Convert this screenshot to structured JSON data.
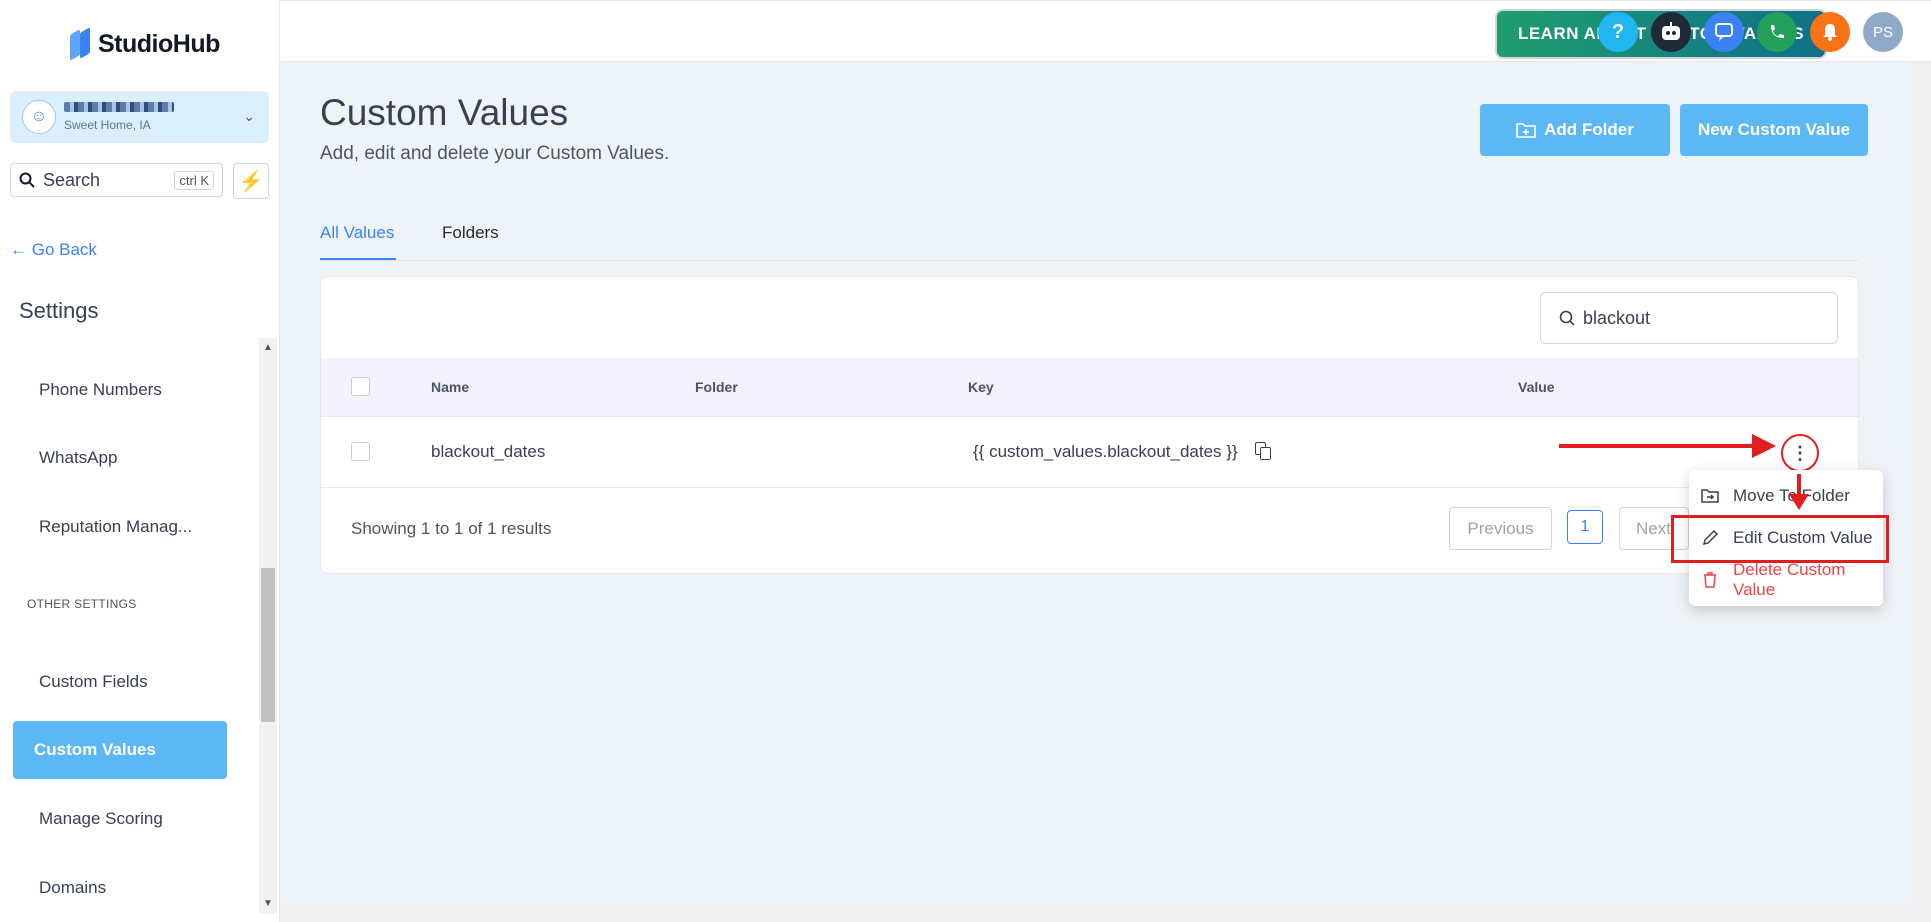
{
  "app": {
    "brand": "StudioHub"
  },
  "account": {
    "location": "Sweet Home, IA"
  },
  "sidebar": {
    "search_label": "Search",
    "search_shortcut": "ctrl K",
    "go_back": "Go Back",
    "section_title": "Settings",
    "items": [
      {
        "label": "Phone Numbers"
      },
      {
        "label": "WhatsApp"
      },
      {
        "label": "Reputation Manag..."
      }
    ],
    "other_settings_header": "OTHER SETTINGS",
    "other_items": [
      {
        "label": "Custom Fields"
      },
      {
        "label": "Custom Values",
        "active": true
      },
      {
        "label": "Manage Scoring"
      },
      {
        "label": "Domains"
      }
    ]
  },
  "topbar": {
    "learn_button": "LEARN ABOUT CUSTOM VALUES",
    "help_glyph": "?",
    "user_initials": "PS",
    "icons": [
      "help-icon",
      "robot-icon",
      "chat-icon",
      "phone-icon",
      "bell-icon",
      "avatar"
    ],
    "colors": {
      "help": "#1fb6f2",
      "robot": "#1f2937",
      "chat": "#3b82f6",
      "phone": "#22a05a",
      "bell": "#f97316",
      "avatar": "#8fa9c8"
    }
  },
  "page": {
    "title": "Custom Values",
    "subtitle": "Add, edit and delete your Custom Values.",
    "add_folder_button": "Add Folder",
    "new_value_button": "New Custom Value"
  },
  "tabs": [
    {
      "label": "All Values",
      "active": true
    },
    {
      "label": "Folders",
      "active": false
    }
  ],
  "table": {
    "search_value": "blackout",
    "columns": [
      "Name",
      "Folder",
      "Key",
      "Value"
    ],
    "rows": [
      {
        "name": "blackout_dates",
        "folder": "",
        "key": "{{ custom_values.blackout_dates }}",
        "value": ""
      }
    ],
    "summary": "Showing 1 to 1 of 1 results",
    "pagination": {
      "previous": "Previous",
      "page": "1",
      "next": "Next"
    }
  },
  "row_menu": {
    "items": [
      {
        "label": "Move To Folder",
        "icon": "folder-move-icon"
      },
      {
        "label": "Edit Custom Value",
        "icon": "pencil-icon"
      },
      {
        "label": "Delete Custom Value",
        "icon": "trash-icon"
      }
    ]
  },
  "colors": {
    "accent": "#3b82f6",
    "primary_button": "#5bb8f5",
    "annotation": "#e11d1d",
    "danger": "#ef4444"
  }
}
